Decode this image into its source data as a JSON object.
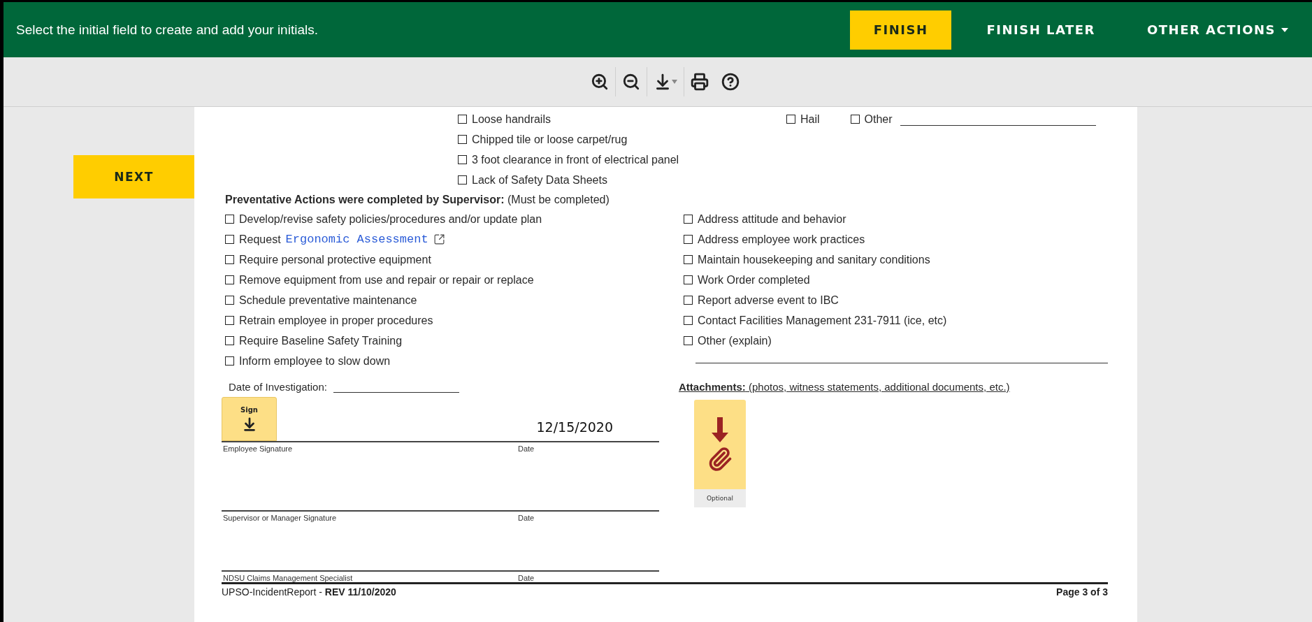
{
  "top_bar": {
    "message": "Select the initial field to create and add your initials.",
    "actions": [
      {
        "label": "FINISH",
        "kind": "primary"
      },
      {
        "label": "FINISH LATER",
        "kind": "text"
      },
      {
        "label": "OTHER ACTIONS",
        "kind": "menu"
      }
    ]
  },
  "toolbar": {
    "tools": [
      {
        "kind": "zoom_in"
      },
      {
        "kind": "zoom_out"
      },
      {
        "kind": "download"
      },
      {
        "kind": "print"
      },
      {
        "kind": "help"
      }
    ]
  },
  "side": {
    "next_button": "NEXT"
  },
  "document": {
    "hazards": [
      {
        "label": "Loose handrails",
        "checked": false
      },
      {
        "label": "Chipped tile or loose carpet/rug",
        "checked": false
      },
      {
        "label": "3 foot clearance in front of electrical panel",
        "checked": false
      },
      {
        "label": "Lack of Safety Data Sheets",
        "checked": false
      }
    ],
    "weather": [
      {
        "label": "Hail",
        "checked": false,
        "blank": false
      },
      {
        "label": "Other",
        "checked": false,
        "blank": true
      }
    ],
    "actions_heading": "**Preventative Actions were completed by Supervisor:** (Must be completed)",
    "actions_left": [
      {
        "label": "Develop/revise safety policies/procedures and/or update plan",
        "checked": false
      },
      {
        "label": "Request",
        "link": "Ergonomic Assessment",
        "checked": false
      },
      {
        "label": "Require personal protective equipment",
        "checked": false
      },
      {
        "label": "Remove equipment from use and repair or repair or replace",
        "checked": false
      },
      {
        "label": "Schedule preventative maintenance",
        "checked": false
      },
      {
        "label": "Retrain employee in proper procedures",
        "checked": false
      },
      {
        "label": "Require Baseline Safety Training",
        "checked": false
      },
      {
        "label": "Inform employee to slow down",
        "checked": false
      }
    ],
    "actions_right": [
      {
        "label": "Address attitude and behavior",
        "checked": false
      },
      {
        "label": "Address employee work practices",
        "checked": false
      },
      {
        "label": "Maintain housekeeping and sanitary conditions",
        "checked": false
      },
      {
        "label": "Work Order completed",
        "checked": false
      },
      {
        "label": "Report adverse event to IBC",
        "checked": false
      },
      {
        "label": "Contact Facilities Management 231-7911 (ice, etc)",
        "checked": false
      },
      {
        "label": "Other (explain)",
        "checked": false
      }
    ],
    "investigation_label": "Date of Investigation:",
    "signatures": [
      {
        "name_label": "Employee Signature",
        "date_label": "Date",
        "date_value": "12/15/2020",
        "sign_tag": "Sign"
      },
      {
        "name_label": "Supervisor or Manager Signature",
        "date_label": "Date"
      },
      {
        "name_label": "NDSU Claims Management Specialist",
        "date_label": "Date"
      }
    ],
    "attachments": {
      "heading": "**Attachments:** (photos, witness statements, additional documents, etc.)",
      "tag": "Optional"
    },
    "footer": {
      "doc": "UPSO-IncidentReport - **REV 11/10/2020**",
      "page": "Page 3 of 3"
    }
  }
}
